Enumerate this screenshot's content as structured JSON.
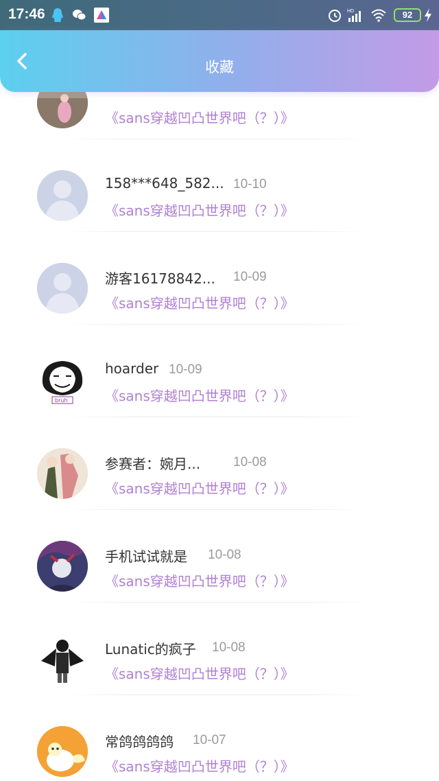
{
  "status_bar": {
    "time": "17:46",
    "battery": "92",
    "network": "HD"
  },
  "header": {
    "title": "收藏"
  },
  "items": [
    {
      "name": "",
      "date": "",
      "novel": "《sans穿越凹凸世界吧（？）》",
      "avatar": "photo-avatar"
    },
    {
      "name": "158***648_582...",
      "date": "10-10",
      "novel": "《sans穿越凹凸世界吧（？）》",
      "avatar": "default-avatar"
    },
    {
      "name": "游客16178842...",
      "date": "10-09",
      "novel": "《sans穿越凹凸世界吧（？）》",
      "avatar": "default-avatar"
    },
    {
      "name": "hoarder",
      "date": "10-09",
      "novel": "《sans穿越凹凸世界吧（？）》",
      "avatar": "bruh-meme-avatar"
    },
    {
      "name": "参赛者：婉月...",
      "date": "10-08",
      "novel": "《sans穿越凹凸世界吧（？）》",
      "avatar": "anime-drawing-avatar"
    },
    {
      "name": "手机试试就是",
      "date": "10-08",
      "novel": "《sans穿越凹凸世界吧（？）》",
      "avatar": "dark-anime-avatar"
    },
    {
      "name": "Lunatic的疯子",
      "date": "10-08",
      "novel": "《sans穿越凹凸世界吧（？）》",
      "avatar": "sketch-character-avatar"
    },
    {
      "name": "常鸽鸽鸽鸽",
      "date": "10-07",
      "novel": "《sans穿越凹凸世界吧（？）》",
      "avatar": "orange-cartoon-avatar"
    }
  ],
  "colors": {
    "header_start": "#5cd0ee",
    "header_end": "#c39be6",
    "novel_title": "#b07fd3",
    "date": "#9a9a9a"
  }
}
